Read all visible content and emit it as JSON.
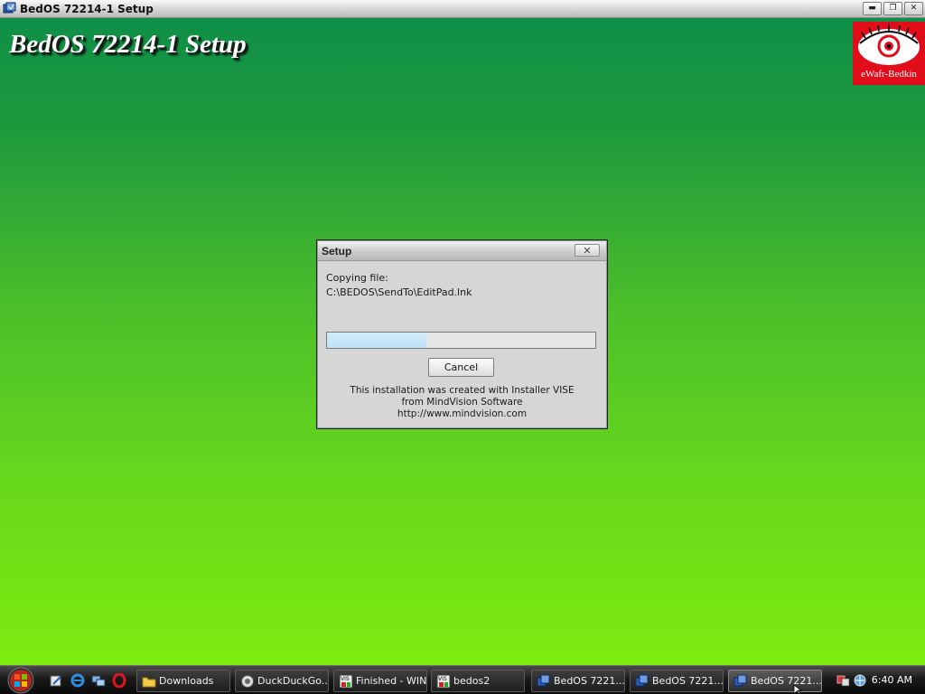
{
  "window": {
    "title": "BedOS 72214-1 Setup",
    "controls": {
      "minimize": "▬",
      "restore": "❐",
      "close": "✕"
    }
  },
  "desktop": {
    "heading": "BedOS 72214-1 Setup",
    "logo_text": "eWafr-Bedkin",
    "gradient_colors": [
      "#0f8f48",
      "#4cbf2a",
      "#7dec10"
    ]
  },
  "dialog": {
    "title": "Setup",
    "close_glyph": "✕",
    "copying_label": "Copying file:",
    "file_path": "C:\\BEDOS\\SendTo\\EditPad.lnk",
    "progress": 0.37,
    "cancel_label": "Cancel",
    "credits_line1": "This installation was created with Installer VISE",
    "credits_line2": "from MindVision Software",
    "credits_line3": "http://www.mindvision.com"
  },
  "taskbar": {
    "quick_launch": [
      "edit-icon",
      "ie-icon",
      "network-icon",
      "opera-icon"
    ],
    "buttons": [
      {
        "label": "Downloads",
        "icon": "folder-icon",
        "active": false
      },
      {
        "label": "DuckDuckGo...",
        "icon": "duck-icon",
        "active": false
      },
      {
        "label": "Finished - WIN",
        "icon": "vise-icon",
        "active": false
      },
      {
        "label": "bedos2",
        "icon": "vise-icon",
        "active": false
      },
      {
        "label": "BedOS 7221...",
        "icon": "setup-icon",
        "active": false
      },
      {
        "label": "BedOS 7221...",
        "icon": "setup-icon",
        "active": false
      },
      {
        "label": "BedOS 7221...",
        "icon": "setup-icon",
        "active": true
      }
    ],
    "clock": "6:40 AM"
  }
}
